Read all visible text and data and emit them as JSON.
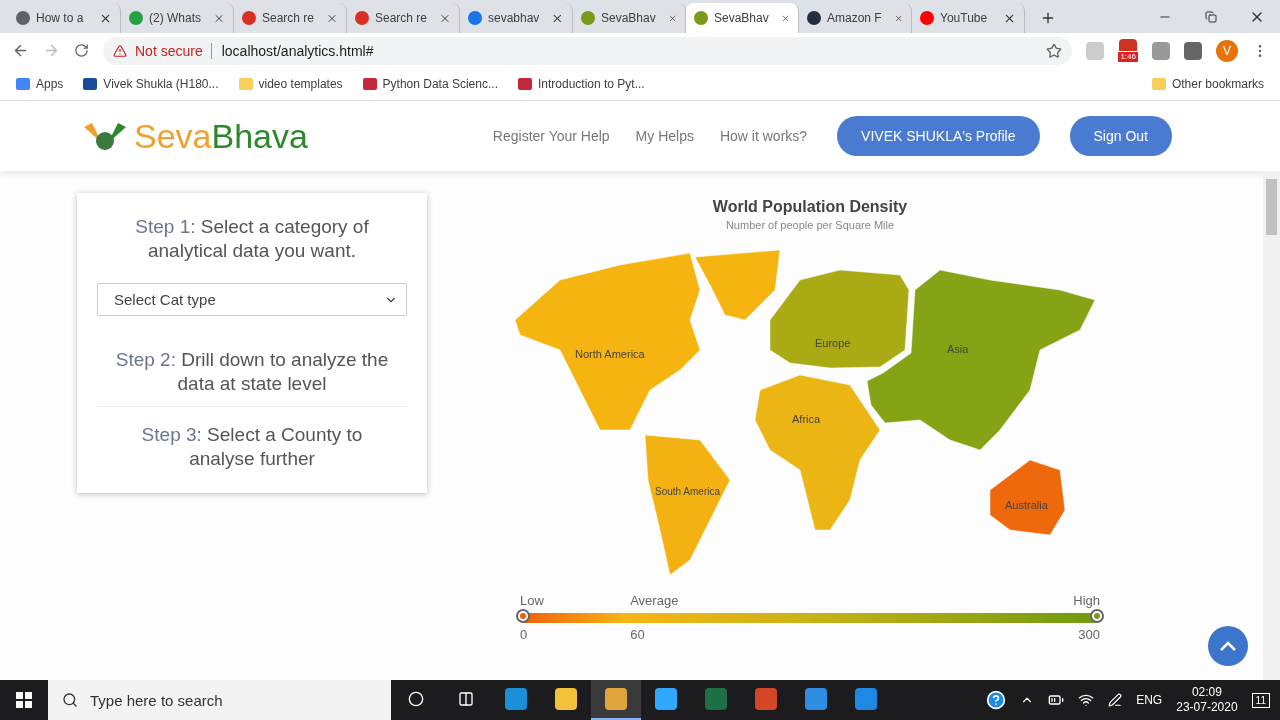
{
  "browser": {
    "tabs": [
      {
        "title": "How to a",
        "selected": false,
        "color": "#5f6368"
      },
      {
        "title": "(2) Whats",
        "selected": false,
        "color": "#25a244"
      },
      {
        "title": "Search re",
        "selected": false,
        "color": "#d93025"
      },
      {
        "title": "Search re",
        "selected": false,
        "color": "#d93025"
      },
      {
        "title": "sevabhav",
        "selected": false,
        "color": "#1a73e8"
      },
      {
        "title": "SevaBhav",
        "selected": false,
        "color": "#7a9a1a"
      },
      {
        "title": "SevaBhav",
        "selected": true,
        "color": "#7a9a1a"
      },
      {
        "title": "Amazon F",
        "selected": false,
        "color": "#232f3e"
      },
      {
        "title": "YouTube",
        "selected": false,
        "color": "#ff0000"
      }
    ],
    "security": "Not secure",
    "url": "localhost/analytics.html#",
    "extension_badge": "1:46",
    "avatar": "V",
    "bookmarks": [
      {
        "label": "Apps",
        "color": "#4285f4"
      },
      {
        "label": "Vivek Shukla (H180...",
        "color": "#1a4b9b"
      },
      {
        "label": "video templates",
        "color": "#f9cd5b"
      },
      {
        "label": "Python Data Scienc...",
        "color": "#c6283b"
      },
      {
        "label": "Introduction to Pyt...",
        "color": "#c6283b"
      }
    ],
    "other_bookmarks": "Other bookmarks"
  },
  "site": {
    "logo_first": "Seva",
    "logo_second": "Bhava",
    "nav": [
      "Register Your Help",
      "My Helps",
      "How it works?"
    ],
    "buttons": [
      "VIVEK SHUKLA's Profile",
      "Sign Out"
    ]
  },
  "steps": [
    {
      "step": "Step 1:",
      "text": "Select a category of analytical data you want."
    },
    {
      "step": "Step 2:",
      "text": "Drill down to analyze the data at state level"
    },
    {
      "step": "Step 3:",
      "text": "Select a County to analyse further"
    }
  ],
  "select": {
    "value": "Select Cat type"
  },
  "map": {
    "title": "World Population Density",
    "subtitle": "Number of people per Square Mile",
    "regions": [
      {
        "name": "North America",
        "color": "#f6b410"
      },
      {
        "name": "South America",
        "color": "#f3b112"
      },
      {
        "name": "Europe",
        "color": "#a9aa14"
      },
      {
        "name": "Asia",
        "color": "#86a316"
      },
      {
        "name": "Africa",
        "color": "#ebb513"
      },
      {
        "name": "Australia",
        "color": "#ee680c"
      }
    ],
    "legend": {
      "labels": [
        "Low",
        "Average",
        "High"
      ],
      "ticks": [
        "0",
        "60",
        "300"
      ]
    }
  },
  "taskbar": {
    "search_placeholder": "Type here to search",
    "apps": [
      {
        "color": "#1b8fd8",
        "selected": false
      },
      {
        "color": "#f3c13a",
        "selected": false
      },
      {
        "color": "#e0a53a",
        "selected": true
      },
      {
        "color": "#31a8ff",
        "selected": false
      },
      {
        "color": "#1d7044",
        "selected": false
      },
      {
        "color": "#d24726",
        "selected": false
      },
      {
        "color": "#2f8ee4",
        "selected": false
      },
      {
        "color": "#1e88e5",
        "selected": false
      }
    ],
    "language": "ENG",
    "time": "02:09",
    "date": "23-07-2020",
    "notifications": "11"
  }
}
